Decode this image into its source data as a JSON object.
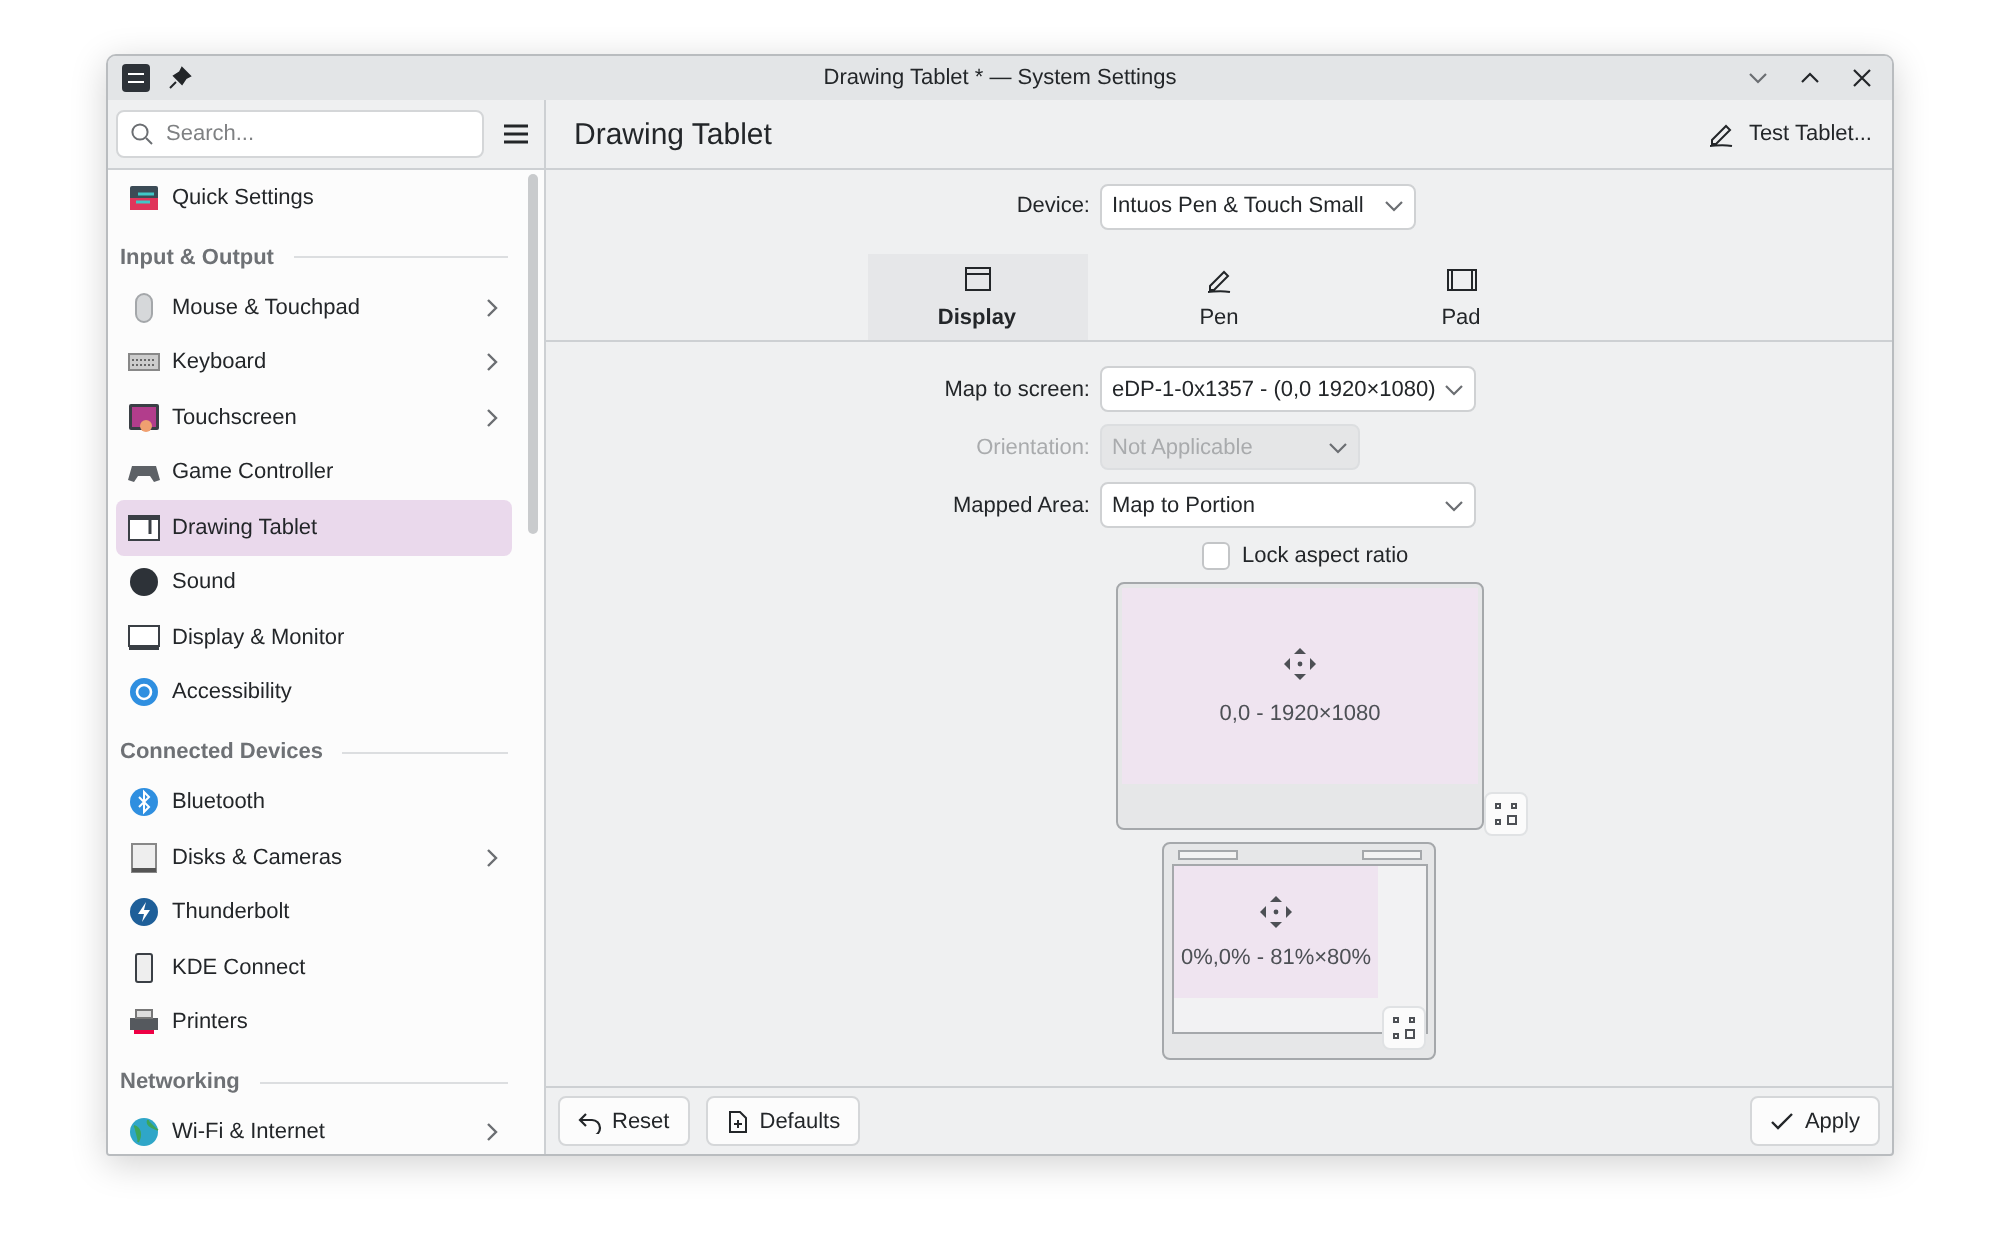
{
  "window": {
    "title": "Drawing Tablet * — System Settings"
  },
  "sidebar": {
    "search": {
      "placeholder": "Search..."
    },
    "items": [
      {
        "kind": "item",
        "label": "Quick Settings",
        "has_children": false,
        "selected": false
      },
      {
        "kind": "header",
        "label": "Input & Output"
      },
      {
        "kind": "item",
        "label": "Mouse & Touchpad",
        "has_children": true,
        "selected": false
      },
      {
        "kind": "item",
        "label": "Keyboard",
        "has_children": true,
        "selected": false
      },
      {
        "kind": "item",
        "label": "Touchscreen",
        "has_children": true,
        "selected": false
      },
      {
        "kind": "item",
        "label": "Game Controller",
        "has_children": false,
        "selected": false
      },
      {
        "kind": "item",
        "label": "Drawing Tablet",
        "has_children": false,
        "selected": true
      },
      {
        "kind": "item",
        "label": "Sound",
        "has_children": false,
        "selected": false
      },
      {
        "kind": "item",
        "label": "Display & Monitor",
        "has_children": false,
        "selected": false
      },
      {
        "kind": "item",
        "label": "Accessibility",
        "has_children": false,
        "selected": false
      },
      {
        "kind": "header",
        "label": "Connected Devices"
      },
      {
        "kind": "item",
        "label": "Bluetooth",
        "has_children": false,
        "selected": false
      },
      {
        "kind": "item",
        "label": "Disks & Cameras",
        "has_children": true,
        "selected": false
      },
      {
        "kind": "item",
        "label": "Thunderbolt",
        "has_children": false,
        "selected": false
      },
      {
        "kind": "item",
        "label": "KDE Connect",
        "has_children": false,
        "selected": false
      },
      {
        "kind": "item",
        "label": "Printers",
        "has_children": false,
        "selected": false
      },
      {
        "kind": "header",
        "label": "Networking"
      },
      {
        "kind": "item",
        "label": "Wi-Fi & Internet",
        "has_children": true,
        "selected": false
      }
    ]
  },
  "page": {
    "title": "Drawing Tablet",
    "test_button": "Test Tablet...",
    "device": {
      "label": "Device:",
      "value": "Intuos Pen & Touch Small"
    },
    "tabs": [
      {
        "label": "Display",
        "selected": true
      },
      {
        "label": "Pen",
        "selected": false
      },
      {
        "label": "Pad",
        "selected": false
      }
    ],
    "form": [
      {
        "label": "Map to screen:",
        "value": "eDP-1-0x1357 - (0,0 1920×1080)",
        "disabled": false
      },
      {
        "label": "Orientation:",
        "value": "Not Applicable",
        "disabled": true
      },
      {
        "label": "Mapped Area:",
        "value": "Map to Portion",
        "disabled": false
      }
    ],
    "lock_aspect": {
      "label": "Lock aspect ratio",
      "checked": false
    },
    "screen_preview": {
      "label": "0,0 - 1920×1080"
    },
    "tablet_preview": {
      "label": "0%,0% - 81%×80%"
    }
  },
  "footer": {
    "buttons": [
      {
        "kind": "reset",
        "label": "Reset"
      },
      {
        "kind": "defaults",
        "label": "Defaults"
      },
      {
        "kind": "apply",
        "label": "Apply"
      }
    ]
  }
}
